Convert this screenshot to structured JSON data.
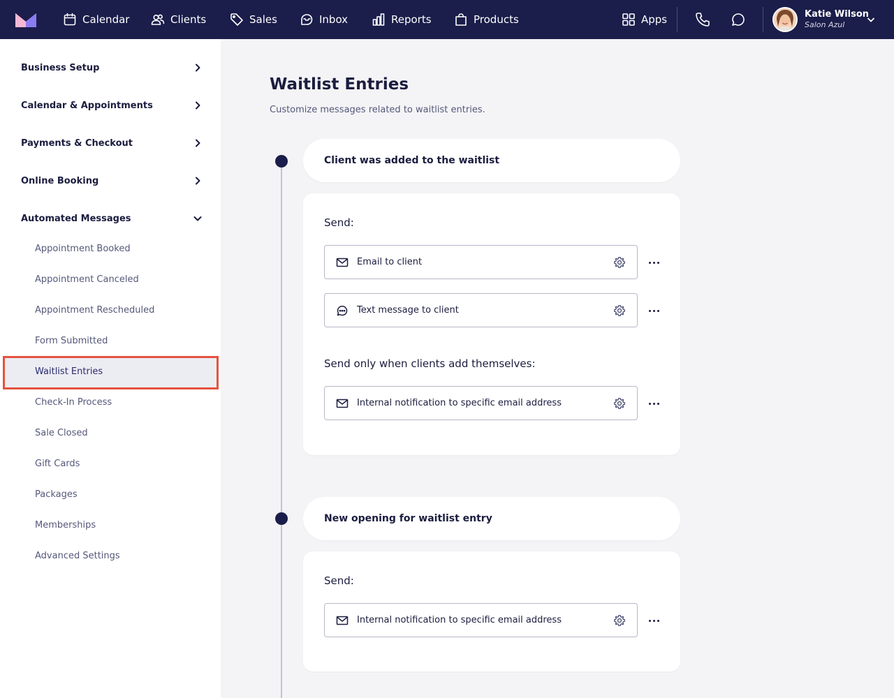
{
  "topnav": {
    "items": [
      {
        "label": "Calendar",
        "icon": "calendar-icon"
      },
      {
        "label": "Clients",
        "icon": "users-icon"
      },
      {
        "label": "Sales",
        "icon": "tag-icon"
      },
      {
        "label": "Inbox",
        "icon": "inbox-icon"
      },
      {
        "label": "Reports",
        "icon": "bar-chart-icon"
      },
      {
        "label": "Products",
        "icon": "shopping-bag-icon"
      }
    ],
    "apps_label": "Apps",
    "user": {
      "name": "Katie Wilson",
      "subtitle": "Salon Azul"
    }
  },
  "sidebar": {
    "sections": [
      {
        "label": "Business Setup",
        "expanded": false
      },
      {
        "label": "Calendar & Appointments",
        "expanded": false
      },
      {
        "label": "Payments & Checkout",
        "expanded": false
      },
      {
        "label": "Online Booking",
        "expanded": false
      },
      {
        "label": "Automated Messages",
        "expanded": true
      }
    ],
    "subitems": [
      "Appointment Booked",
      "Appointment Canceled",
      "Appointment Rescheduled",
      "Form Submitted",
      "Waitlist Entries",
      "Check-In Process",
      "Sale Closed",
      "Gift Cards",
      "Packages",
      "Memberships",
      "Advanced Settings"
    ],
    "active_subitem": "Waitlist Entries"
  },
  "main": {
    "title": "Waitlist Entries",
    "description": "Customize messages related to waitlist entries.",
    "events": [
      {
        "title": "Client was added to the waitlist",
        "groups": [
          {
            "label": "Send:",
            "rows": [
              {
                "icon": "mail-icon",
                "text": "Email to client"
              },
              {
                "icon": "chat-bubble-icon",
                "text": "Text message to client"
              }
            ]
          },
          {
            "label": "Send only when clients add themselves:",
            "rows": [
              {
                "icon": "mail-icon",
                "text": "Internal notification to specific email address"
              }
            ]
          }
        ]
      },
      {
        "title": "New opening for waitlist entry",
        "groups": [
          {
            "label": "Send:",
            "rows": [
              {
                "icon": "mail-icon",
                "text": "Internal notification to specific email address"
              }
            ]
          }
        ]
      }
    ]
  },
  "colors": {
    "nav_bg": "#1b1d4a",
    "page_bg": "#f4f4f6",
    "active_highlight_border": "#e5533f",
    "active_highlight_bg": "#ececf3",
    "logo_pink": "#f0a0c8",
    "logo_purple": "#8a7cf0"
  }
}
